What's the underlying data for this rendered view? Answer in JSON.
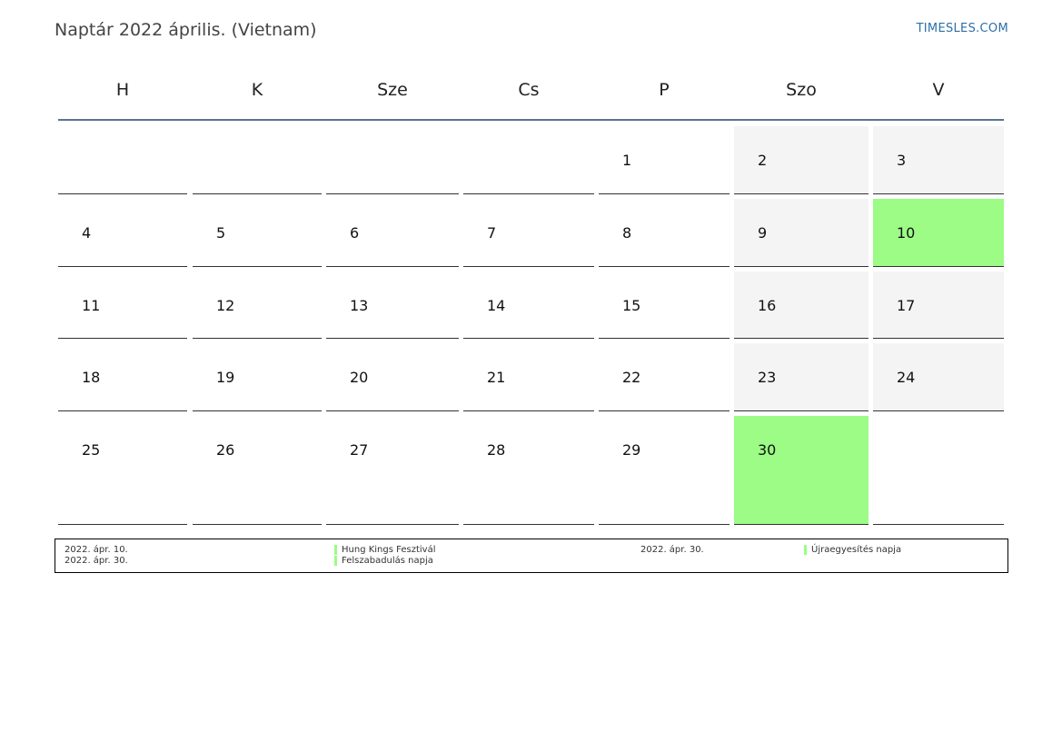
{
  "header": {
    "title": "Naptár 2022 április. (Vietnam)",
    "brand": "TIMESLES.COM"
  },
  "weekdays": [
    "H",
    "K",
    "Sze",
    "Cs",
    "P",
    "Szo",
    "V"
  ],
  "weeks": [
    [
      "",
      "",
      "",
      "",
      "1",
      "2",
      "3"
    ],
    [
      "4",
      "5",
      "6",
      "7",
      "8",
      "9",
      "10"
    ],
    [
      "11",
      "12",
      "13",
      "14",
      "15",
      "16",
      "17"
    ],
    [
      "18",
      "19",
      "20",
      "21",
      "22",
      "23",
      "24"
    ],
    [
      "25",
      "26",
      "27",
      "28",
      "29",
      "30",
      ""
    ]
  ],
  "holidays": [
    "10",
    "30"
  ],
  "colors": {
    "holiday": "#9cfc85",
    "weekend": "#f4f4f4",
    "header_rule": "#5a7390",
    "brand": "#2d6fa8"
  },
  "legend": {
    "col1": {
      "dates": [
        "2022. ápr. 10.",
        "2022. ápr. 30."
      ],
      "names": [
        "Hung Kings Fesztivál",
        "Felszabadulás napja"
      ]
    },
    "col2": {
      "dates": [
        "2022. ápr. 30."
      ],
      "names": [
        "Újraegyesítés napja"
      ]
    }
  }
}
